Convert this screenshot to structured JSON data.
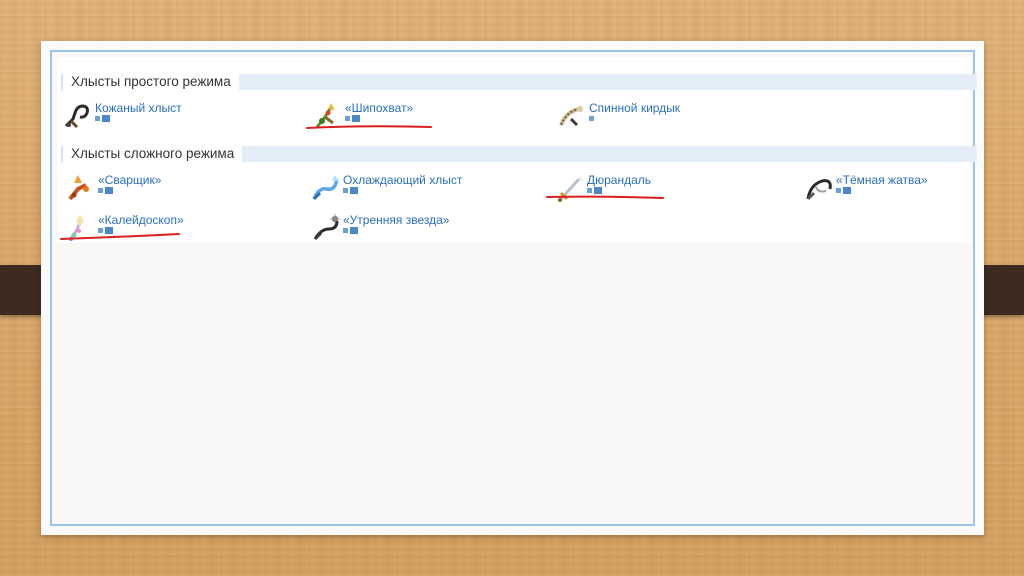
{
  "sections": [
    {
      "title": "Хлысты простого режима",
      "items": [
        {
          "name": "Кожаный хлыст",
          "icon": "leather-whip-icon"
        },
        {
          "name": "«Шипохват»",
          "icon": "snapthorn-icon"
        },
        {
          "name": "Спинной кирдык",
          "icon": "spinal-tap-icon"
        }
      ]
    },
    {
      "title": "Хлысты сложного режима",
      "items": [
        {
          "name": "«Сварщик»",
          "icon": "firecracker-icon"
        },
        {
          "name": "Охлаждающий хлыст",
          "icon": "cool-whip-icon"
        },
        {
          "name": "Дюрандаль",
          "icon": "durendal-icon"
        },
        {
          "name": "«Тёмная жатва»",
          "icon": "dark-harvest-icon"
        },
        {
          "name": "«Калейдоскоп»",
          "icon": "kaleidoscope-icon"
        },
        {
          "name": "«Утренняя звезда»",
          "icon": "morning-star-icon"
        }
      ]
    }
  ],
  "colors": {
    "link": "#2a6fc0",
    "header_band": "#e4eef8",
    "frame_border": "#9cc4e6",
    "underline": "#d92020",
    "clip": "#3d2a20"
  }
}
